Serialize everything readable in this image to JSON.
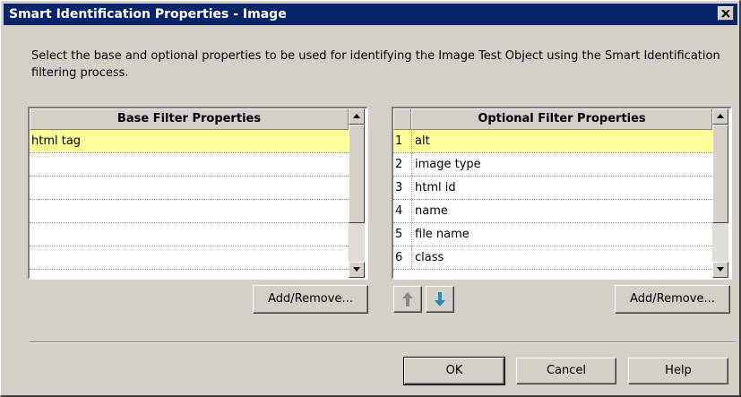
{
  "window": {
    "title": "Smart Identification Properties - Image",
    "close_icon": "close-icon"
  },
  "description": "Select the base and optional properties to be used for identifying the Image Test Object using the Smart Identification filtering process.",
  "base_filter": {
    "header": "Base Filter Properties",
    "rows": [
      "html tag",
      "",
      "",
      "",
      "",
      ""
    ],
    "selected_index": 0,
    "add_remove_label": "Add/Remove..."
  },
  "optional_filter": {
    "header": "Optional Filter Properties",
    "rows": [
      {
        "num": "1",
        "label": "alt"
      },
      {
        "num": "2",
        "label": "image type"
      },
      {
        "num": "3",
        "label": "html id"
      },
      {
        "num": "4",
        "label": "name"
      },
      {
        "num": "5",
        "label": "file name"
      },
      {
        "num": "6",
        "label": "class"
      }
    ],
    "selected_index": 0,
    "move_up_icon": "arrow-up-icon",
    "move_down_icon": "arrow-down-icon",
    "add_remove_label": "Add/Remove..."
  },
  "footer": {
    "ok_label": "OK",
    "cancel_label": "Cancel",
    "help_label": "Help"
  },
  "colors": {
    "title_bar": "#0a246a",
    "selected_row": "#ffff99",
    "face": "#d4d0c8"
  }
}
